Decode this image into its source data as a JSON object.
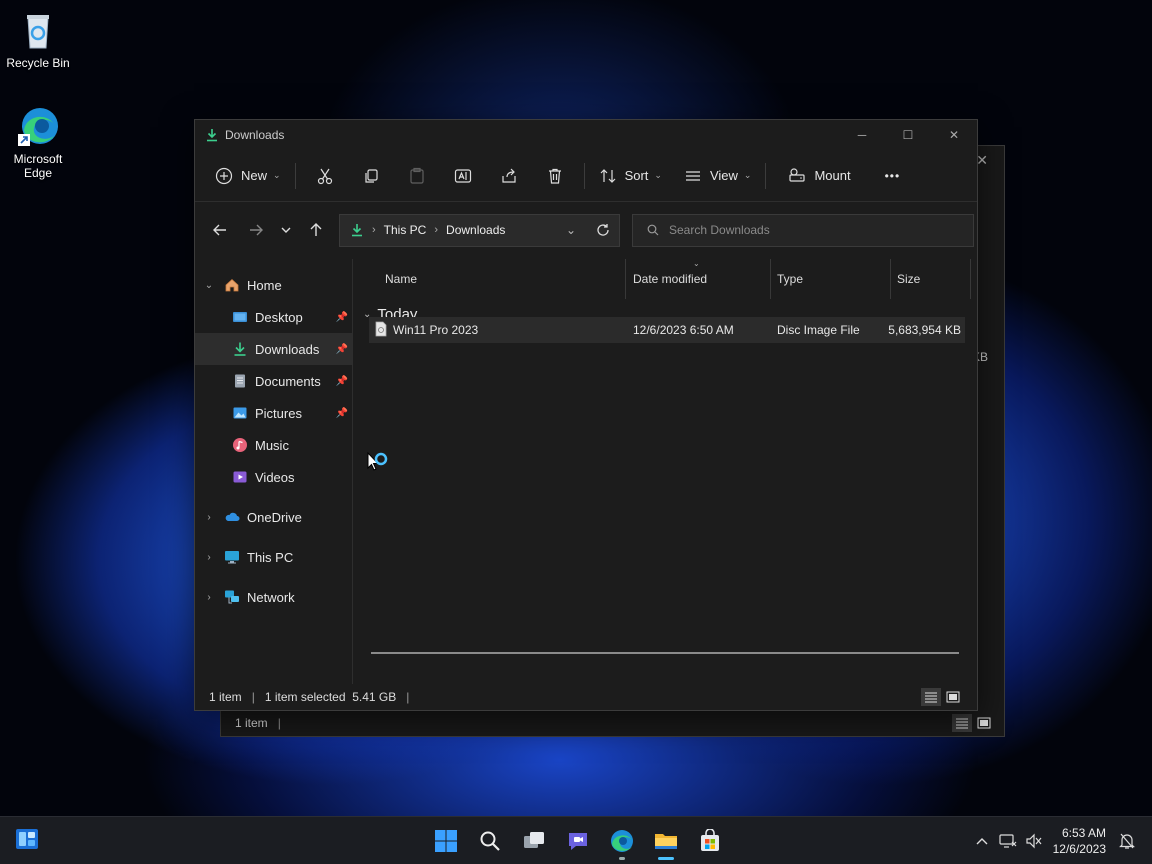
{
  "desktop": {
    "icons": [
      {
        "label": "Recycle Bin",
        "icon": "recycle-bin-icon"
      },
      {
        "label_line1": "Microsoft",
        "label_line2": "Edge",
        "icon": "edge-icon"
      }
    ]
  },
  "back_window": {
    "status_items": "1 item",
    "partial_size_text": "KB"
  },
  "window": {
    "title": "Downloads",
    "controls": {
      "minimize": "─",
      "maximize": "☐",
      "close": "✕"
    },
    "toolbar": {
      "new_label": "New",
      "sort_label": "Sort",
      "view_label": "View",
      "mount_label": "Mount",
      "more_label": "•••"
    },
    "address": {
      "segments": [
        "This PC",
        "Downloads"
      ]
    },
    "search": {
      "placeholder": "Search Downloads"
    },
    "sidebar": {
      "home": "Home",
      "quick_access": [
        {
          "label": "Desktop",
          "icon": "desktop-icon",
          "pinned": true
        },
        {
          "label": "Downloads",
          "icon": "downloads-icon",
          "pinned": true,
          "selected": true
        },
        {
          "label": "Documents",
          "icon": "documents-icon",
          "pinned": true
        },
        {
          "label": "Pictures",
          "icon": "pictures-icon",
          "pinned": true
        },
        {
          "label": "Music",
          "icon": "music-icon",
          "pinned": false
        },
        {
          "label": "Videos",
          "icon": "videos-icon",
          "pinned": false
        }
      ],
      "onedrive": "OneDrive",
      "this_pc": "This PC",
      "network": "Network"
    },
    "columns": {
      "name": "Name",
      "date": "Date modified",
      "type": "Type",
      "size": "Size"
    },
    "group": "Today",
    "files": [
      {
        "name": "Win11 Pro 2023",
        "date": "12/6/2023 6:50 AM",
        "type": "Disc Image File",
        "size": "5,683,954 KB"
      }
    ],
    "status": {
      "items": "1 item",
      "selected": "1 item selected  5.41 GB"
    }
  },
  "taskbar": {
    "time": "6:53 AM",
    "date": "12/6/2023"
  },
  "colors": {
    "accent": "#4cc2ff",
    "window_bg": "#1c1c1c",
    "selected_row": "#2b2b2b"
  }
}
